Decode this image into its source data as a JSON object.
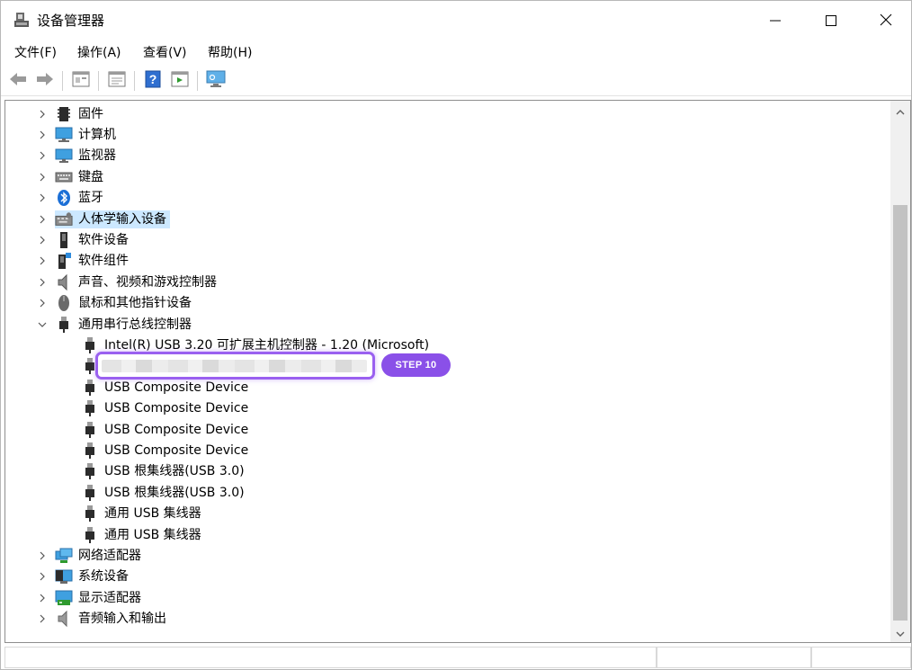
{
  "window": {
    "title": "设备管理器",
    "minimize_icon": "minimize-icon",
    "maximize_icon": "maximize-icon",
    "close_icon": "close-icon"
  },
  "menu": [
    "文件(F)",
    "操作(A)",
    "查看(V)",
    "帮助(H)"
  ],
  "toolbar": [
    "back-arrow-icon",
    "forward-arrow-icon",
    "properties-icon",
    "update-driver-icon",
    "help-icon",
    "show-hidden-icon",
    "monitor-scan-icon"
  ],
  "tree": {
    "categories_top": [
      {
        "label": "固件",
        "icon": "firmware-chip-icon"
      },
      {
        "label": "计算机",
        "icon": "computer-icon"
      },
      {
        "label": "监视器",
        "icon": "monitor-icon"
      },
      {
        "label": "键盘",
        "icon": "keyboard-icon"
      },
      {
        "label": "蓝牙",
        "icon": "bluetooth-icon"
      },
      {
        "label": "人体学输入设备",
        "icon": "hid-icon",
        "selected": true
      },
      {
        "label": "软件设备",
        "icon": "software-device-icon"
      },
      {
        "label": "软件组件",
        "icon": "software-component-icon"
      },
      {
        "label": "声音、视频和游戏控制器",
        "icon": "speaker-icon"
      },
      {
        "label": "鼠标和其他指针设备",
        "icon": "mouse-icon"
      }
    ],
    "usb_category": {
      "label": "通用串行总线控制器",
      "icon": "usb-plug-icon",
      "expanded": true
    },
    "usb_children": [
      "Intel(R) USB 3.20 可扩展主机控制器 - 1.20 (Microsoft)",
      "",
      "USB Composite Device",
      "USB Composite Device",
      "USB Composite Device",
      "USB Composite Device",
      "USB 根集线器(USB 3.0)",
      "USB 根集线器(USB 3.0)",
      "通用 USB 集线器",
      "通用 USB 集线器"
    ],
    "categories_bottom": [
      {
        "label": "网络适配器",
        "icon": "network-adapter-icon"
      },
      {
        "label": "系统设备",
        "icon": "system-device-icon"
      },
      {
        "label": "显示适配器",
        "icon": "display-adapter-icon"
      },
      {
        "label": "音频输入和输出",
        "icon": "audio-io-icon"
      }
    ]
  },
  "annotation": {
    "step_label": "STEP 10",
    "accent": "#8a50e8"
  }
}
